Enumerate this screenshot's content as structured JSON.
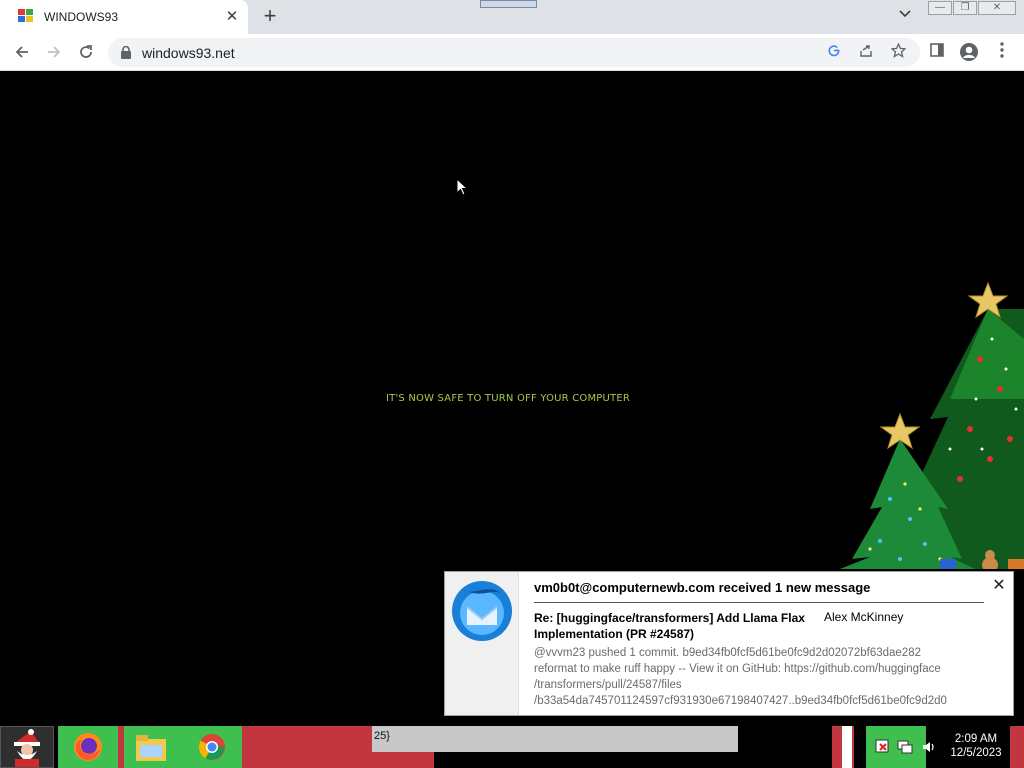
{
  "browser": {
    "tab_title": "WINDOWS93",
    "url": "windows93.net",
    "newtab_label": "+",
    "tab_close_label": "✕",
    "window_controls": {
      "minimize": "—",
      "restore": "❐",
      "close": "✕"
    }
  },
  "page": {
    "message": "IT'S NOW SAFE TO TURN OFF YOUR COMPUTER",
    "message_color": "#a6c94a",
    "background": "#000000"
  },
  "notification": {
    "header": "vm0b0t@computernewb.com received 1 new message",
    "subject": "Re: [huggingface/transformers] Add Llama Flax Implementation (PR #24587)",
    "from": "Alex McKinney",
    "body_lines": [
      "@vvvm23 pushed 1 commit. b9ed34fb0fcf5d61be0fc9d2d02072bf63dae282",
      "reformat to make ruff happy -- View it on GitHub: https://github.com/huggingface",
      "/transformers/pull/24587/files",
      "/b33a54da745701124597cf931930e67198407427..b9ed34fb0fcf5d61be0fc9d2d0"
    ],
    "close_label": "✕"
  },
  "taskbar": {
    "address_text": "25}",
    "clock_time": "2:09 AM",
    "clock_date": "12/5/2023"
  },
  "colors": {
    "chrome_tabstrip": "#dee1e6",
    "omnibox": "#f1f3f4",
    "taskbar_green": "#3fbf4f",
    "taskbar_red": "#c2373f",
    "thunderbird_blue": "#1a7fd6"
  }
}
